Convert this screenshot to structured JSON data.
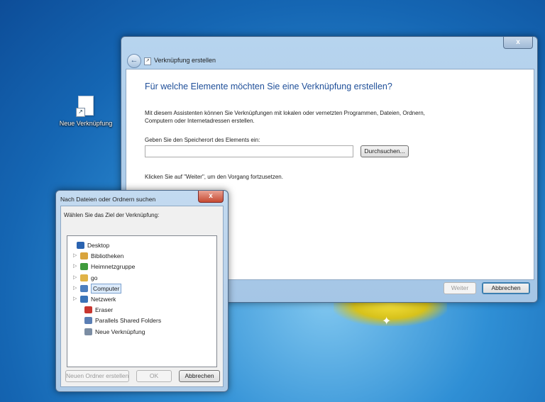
{
  "desktop": {
    "icon_label": "Neue Verknüpfung"
  },
  "wizard": {
    "title": "Verknüpfung erstellen",
    "close_glyph": "x",
    "heading": "Für welche Elemente möchten Sie eine Verknüpfung erstellen?",
    "description": "Mit diesem Assistenten können Sie Verknüpfungen mit lokalen oder vernetzten Programmen, Dateien, Ordnern, Computern oder Internetadressen erstellen.",
    "location_label": "Geben Sie den Speicherort des Elements ein:",
    "location_value": "",
    "browse_label": "Durchsuchen...",
    "hint": "Klicken Sie auf \"Weiter\", um den Vorgang fortzusetzen.",
    "next_label": "Weiter",
    "cancel_label": "Abbrechen"
  },
  "dialog": {
    "title": "Nach Dateien oder Ordnern suchen",
    "close_glyph": "x",
    "prompt": "Wählen Sie das Ziel der Verknüpfung:",
    "tree": [
      {
        "label": "Desktop",
        "icon": "desktop-icon",
        "color": "#2a63b0",
        "expandable": false
      },
      {
        "label": "Bibliotheken",
        "icon": "libraries-icon",
        "color": "#d9a43c",
        "expandable": true
      },
      {
        "label": "Heimnetzgruppe",
        "icon": "homegroup-icon",
        "color": "#3f9b3c",
        "expandable": true
      },
      {
        "label": "go",
        "icon": "user-folder-icon",
        "color": "#e0b347",
        "expandable": true
      },
      {
        "label": "Computer",
        "icon": "computer-icon",
        "color": "#4d7fbf",
        "expandable": true,
        "selected": true
      },
      {
        "label": "Netzwerk",
        "icon": "network-icon",
        "color": "#3a74b8",
        "expandable": true
      },
      {
        "label": "Eraser",
        "icon": "eraser-icon",
        "color": "#c8362f",
        "expandable": false
      },
      {
        "label": "Parallels Shared Folders",
        "icon": "shared-folders-icon",
        "color": "#5a7eb4",
        "expandable": false
      },
      {
        "label": "Neue Verknüpfung",
        "icon": "shortcut-icon",
        "color": "#7b8da3",
        "expandable": false
      }
    ],
    "new_folder_label": "Neuen Ordner erstellen",
    "ok_label": "OK",
    "cancel_label": "Abbrechen"
  }
}
